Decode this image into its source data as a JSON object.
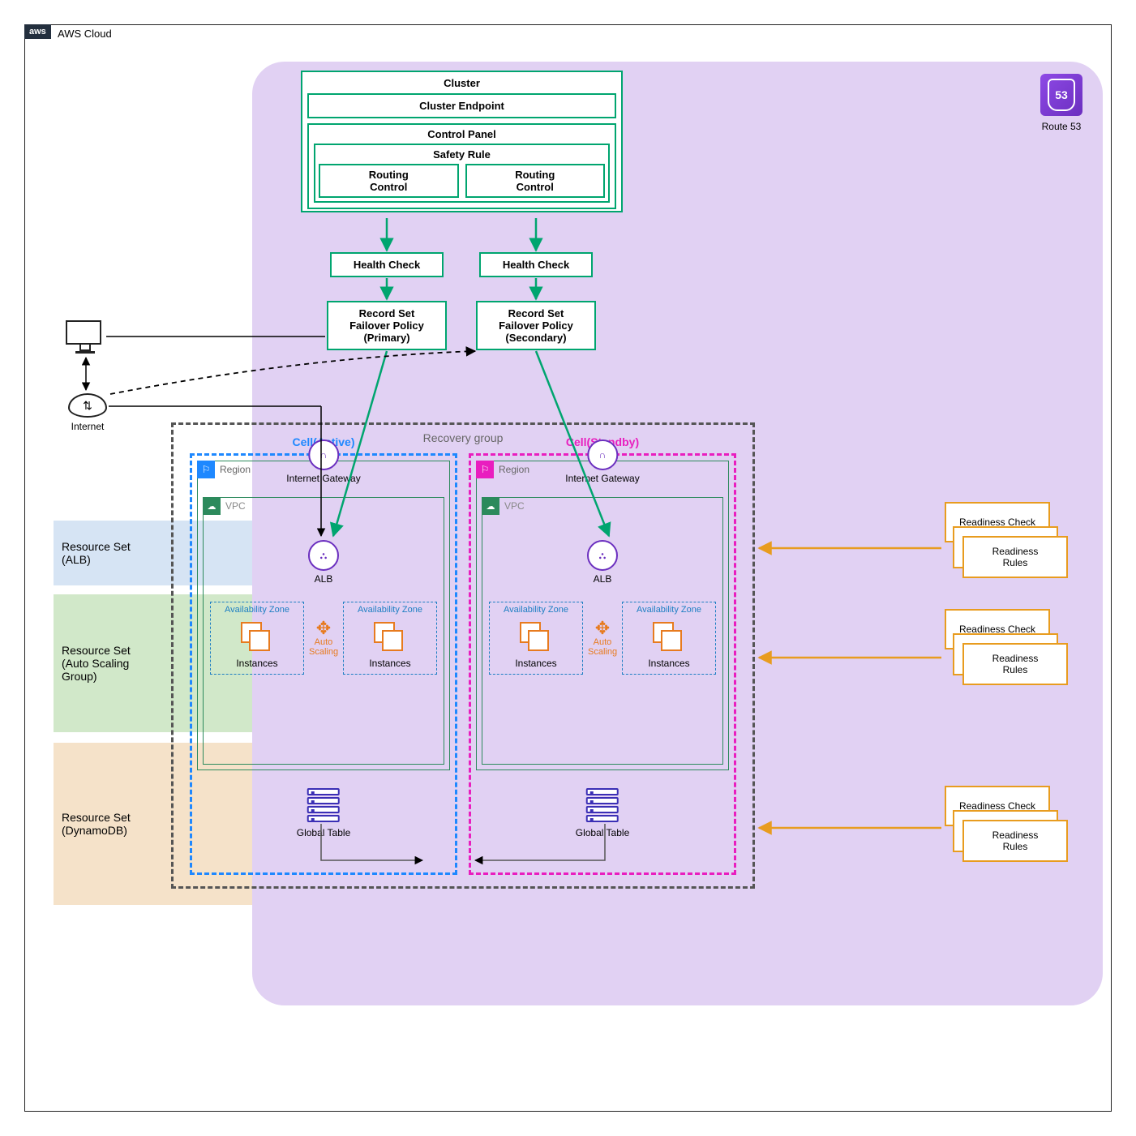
{
  "awsCloud": "AWS Cloud",
  "route53": "Route 53",
  "cluster": {
    "title": "Cluster",
    "endpoint": "Cluster Endpoint",
    "controlPanel": "Control Panel",
    "safetyRule": "Safety Rule",
    "routing1": "Routing\nControl",
    "routing2": "Routing\nControl"
  },
  "healthCheck1": "Health Check",
  "healthCheck2": "Health Check",
  "recordSet1": "Record Set\nFailover Policy\n(Primary)",
  "recordSet2": "Record Set\nFailover Policy\n(Secondary)",
  "internet": "Internet",
  "recoveryGroup": "Recovery group",
  "cellActive": "Cell(Active)",
  "cellStandby": "Cell(Standby)",
  "region": "Region",
  "vpc": "VPC",
  "igw": "Internet Gateway",
  "alb": "ALB",
  "az": "Availability Zone",
  "instances": "Instances",
  "autoScaling": "Auto\nScaling",
  "globalTable": "Global Table",
  "dynamodb": "Amazon DynamoDB",
  "bands": {
    "alb": "Resource Set\n(ALB)",
    "asg": "Resource Set\n(Auto Scaling\nGroup)",
    "ddb": "Resource Set\n(DynamoDB)"
  },
  "readiness": {
    "check": "Readiness Check",
    "rules": "Readiness\nRules"
  }
}
